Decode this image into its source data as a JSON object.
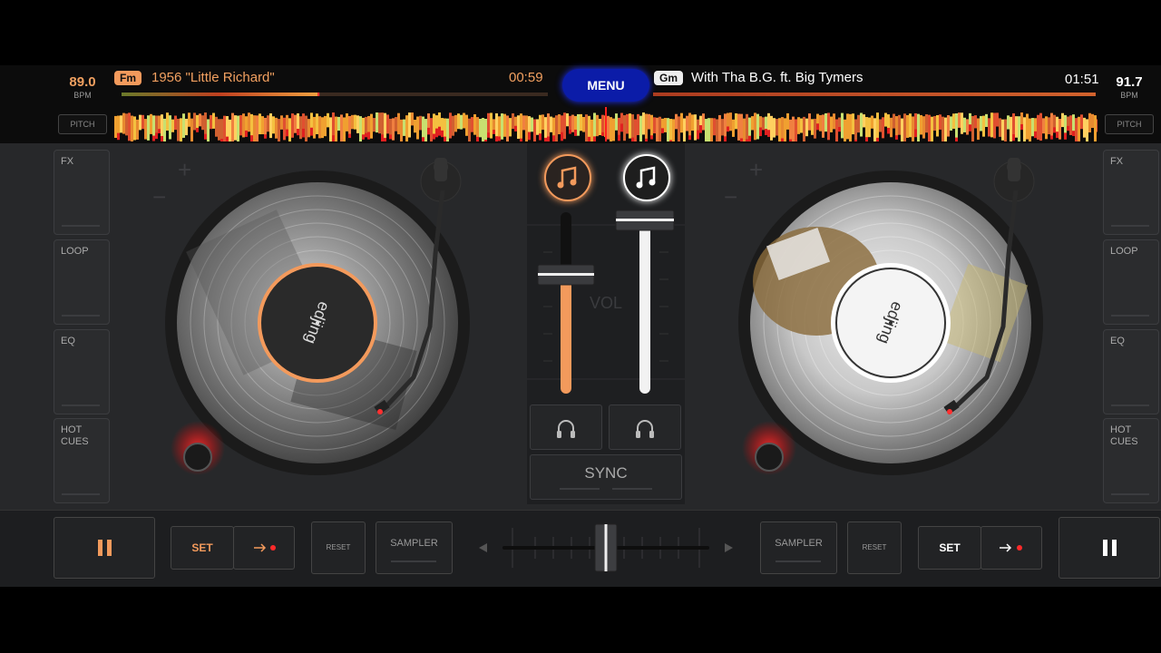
{
  "deck_left": {
    "bpm": "89.0",
    "bpm_unit": "BPM",
    "pitch_label": "PITCH",
    "key": "Fm",
    "title": "1956 \"Little Richard\"",
    "time": "00:59",
    "side_buttons": [
      "FX",
      "LOOP",
      "EQ",
      "HOT CUES"
    ],
    "label_text": "edjing",
    "accent": "#f39a5c",
    "position": 0.46
  },
  "deck_right": {
    "bpm": "91.7",
    "bpm_unit": "BPM",
    "pitch_label": "PITCH",
    "key": "Gm",
    "title": "With Tha B.G. ft. Big Tymers",
    "time": "01:51",
    "side_buttons": [
      "FX",
      "LOOP",
      "EQ",
      "HOT CUES"
    ],
    "label_text": "edjing",
    "accent": "#ffffff"
  },
  "menu_label": "MENU",
  "mixer": {
    "vol_label": "VOL",
    "sync_label": "SYNC",
    "left_volume": 0.66,
    "right_volume": 0.96,
    "crossfader": 0.5
  },
  "bottom_left": {
    "set_label": "SET",
    "reset_label": "RESET",
    "sampler_label": "SAMPLER"
  },
  "bottom_right": {
    "set_label": "SET",
    "reset_label": "RESET",
    "sampler_label": "SAMPLER"
  },
  "icons": {
    "pause": "pause-icon",
    "arrow": "arrow-right-icon",
    "headphones": "headphones-icon",
    "music": "music-note-icon"
  }
}
